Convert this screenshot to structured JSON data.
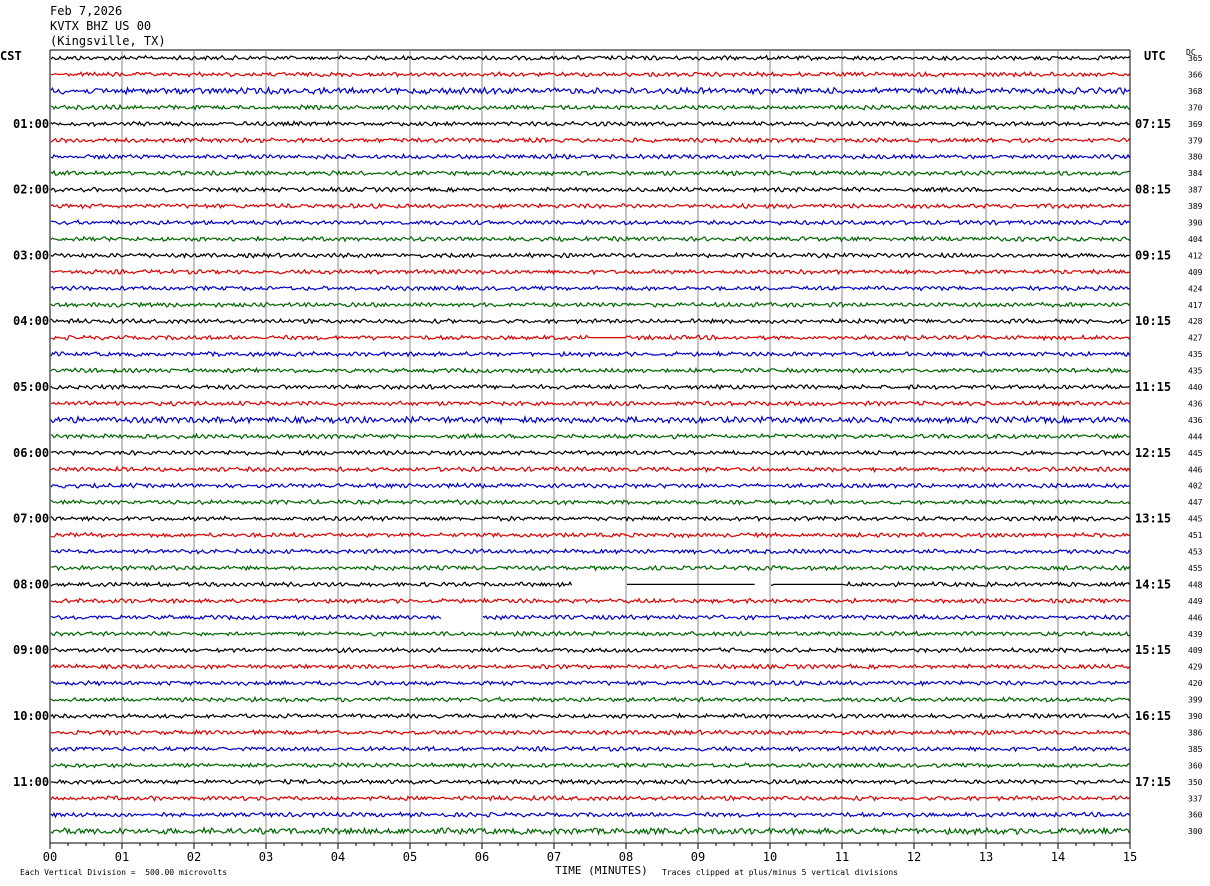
{
  "header": {
    "date": "Feb 7,2026",
    "station": "KVTX BHZ US 00",
    "location": "(Kingsville, TX)"
  },
  "left_zone": "CST",
  "right_zone": "UTC",
  "dc_label": "DC",
  "footer": {
    "scale_note": "Each Vertical Division =  500.00 microvolts",
    "xlabel": "TIME (MINUTES)",
    "clip_note": "Traces clipped at plus/minus 5 vertical divisions"
  },
  "colors": {
    "cycle": [
      "#000000",
      "#dd0000",
      "#0000cc",
      "#006600"
    ],
    "grid": "#888888"
  },
  "chart_data": {
    "type": "line",
    "title": "KVTX BHZ US 00",
    "xlabel": "TIME (MINUTES)",
    "xlim": [
      0,
      15
    ],
    "x_ticks": [
      "00",
      "01",
      "02",
      "03",
      "04",
      "05",
      "06",
      "07",
      "08",
      "09",
      "10",
      "11",
      "12",
      "13",
      "14",
      "15"
    ],
    "trace_count": 48,
    "left_time_labels": [
      "01:00",
      "02:00",
      "03:00",
      "04:00",
      "05:00",
      "06:00",
      "07:00",
      "08:00",
      "09:00",
      "10:00",
      "11:00"
    ],
    "right_time_labels": [
      "07:15",
      "08:15",
      "09:15",
      "10:15",
      "11:15",
      "12:15",
      "13:15",
      "14:15",
      "15:15",
      "16:15",
      "17:15"
    ],
    "dc_values": [
      "365",
      "366",
      "368",
      "370",
      "369",
      "379",
      "380",
      "384",
      "387",
      "389",
      "390",
      "404",
      "412",
      "409",
      "424",
      "417",
      "428",
      "427",
      "435",
      "435",
      "440",
      "436",
      "436",
      "444",
      "445",
      "446",
      "402",
      "447",
      "445",
      "451",
      "453",
      "455",
      "448",
      "449",
      "446",
      "439",
      "409",
      "429",
      "420",
      "399",
      "390",
      "386",
      "385",
      "360",
      "350",
      "337",
      "360",
      "300"
    ],
    "gaps": [
      {
        "trace": 17,
        "x": [
          7.5,
          8.0
        ],
        "style": "flat"
      },
      {
        "trace": 32,
        "x": [
          7.25,
          8.0
        ],
        "style": "blank"
      },
      {
        "trace": 32,
        "x": [
          8.0,
          9.8
        ],
        "style": "flat"
      },
      {
        "trace": 32,
        "x": [
          9.8,
          10.0
        ],
        "style": "blank"
      },
      {
        "trace": 32,
        "x": [
          10.05,
          11.0
        ],
        "style": "flat"
      },
      {
        "trace": 34,
        "x": [
          5.45,
          6.0
        ],
        "style": "blank"
      }
    ]
  }
}
